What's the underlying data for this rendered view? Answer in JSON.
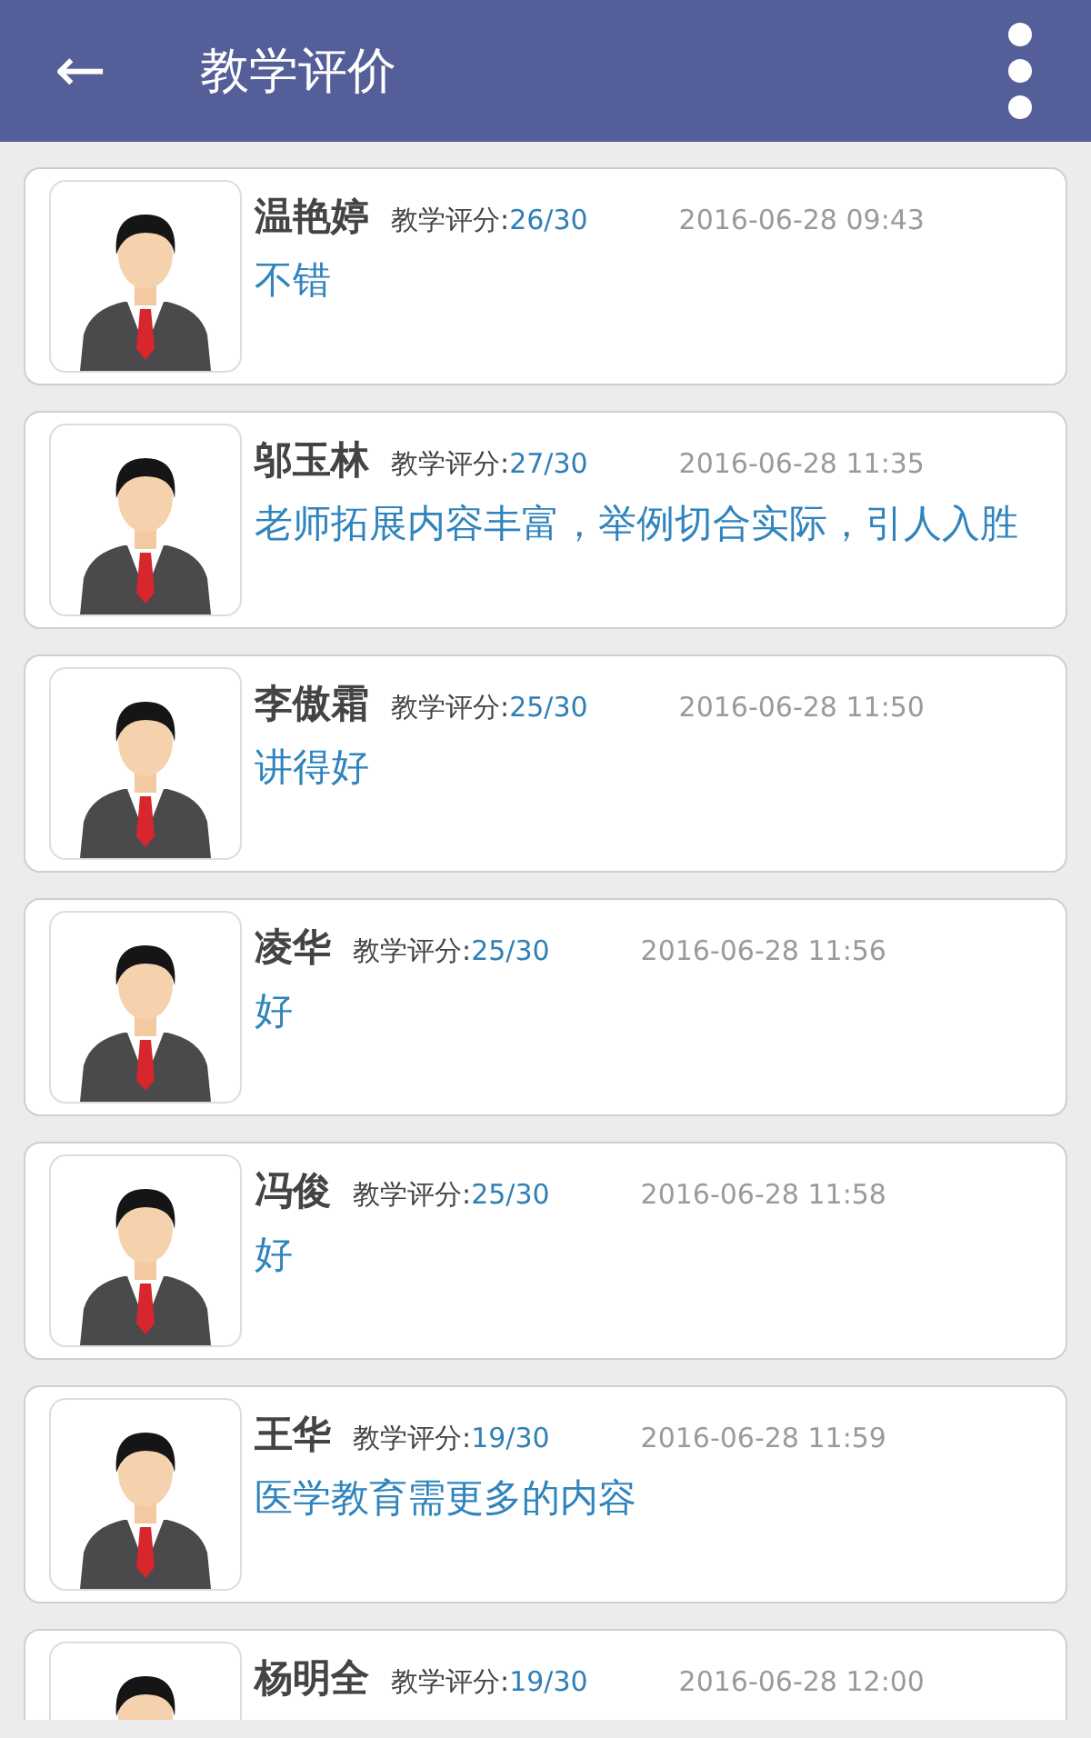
{
  "app_bar": {
    "back": "←",
    "title": "教学评价"
  },
  "reviews": [
    {
      "name": "温艳婷",
      "score_label": "教学评分:",
      "score": "26/30",
      "time": "2016-06-28 09:43",
      "comment": "不错"
    },
    {
      "name": "邬玉林",
      "score_label": "教学评分:",
      "score": "27/30",
      "time": "2016-06-28 11:35",
      "comment": "老师拓展内容丰富，举例切合实际，引人入胜"
    },
    {
      "name": "李傲霜",
      "score_label": "教学评分:",
      "score": "25/30",
      "time": "2016-06-28 11:50",
      "comment": "讲得好"
    },
    {
      "name": "凌华",
      "score_label": "教学评分:",
      "score": "25/30",
      "time": "2016-06-28 11:56",
      "comment": "好"
    },
    {
      "name": "冯俊",
      "score_label": "教学评分:",
      "score": "25/30",
      "time": "2016-06-28 11:58",
      "comment": "好"
    },
    {
      "name": "王华",
      "score_label": "教学评分:",
      "score": "19/30",
      "time": "2016-06-28 11:59",
      "comment": "医学教育需更多的内容"
    },
    {
      "name": "杨明全",
      "score_label": "教学评分:",
      "score": "19/30",
      "time": "2016-06-28 12:00"
    }
  ]
}
